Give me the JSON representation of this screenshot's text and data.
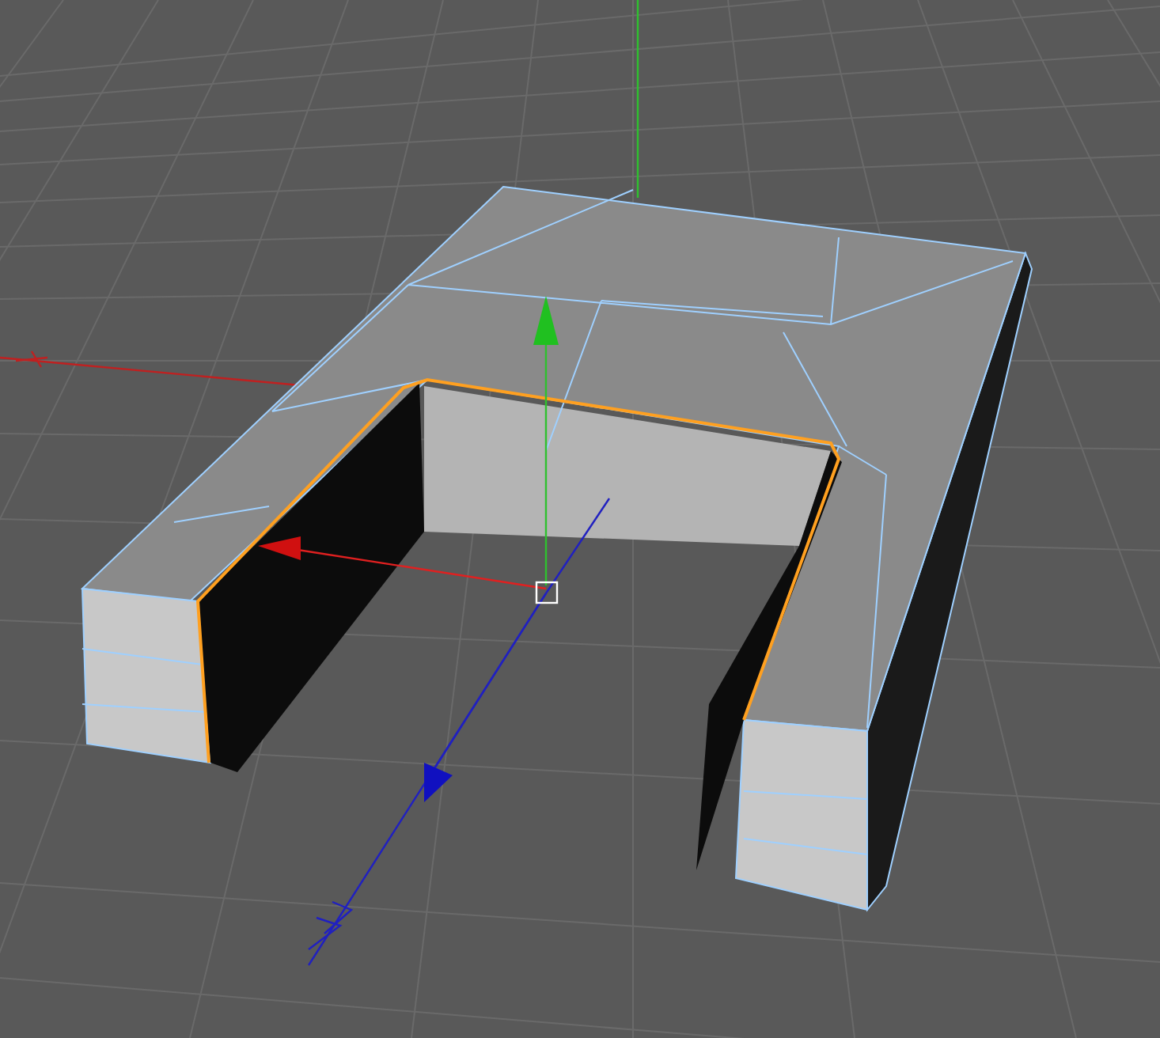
{
  "viewport": {
    "grid": true,
    "model": {
      "selected": true
    },
    "gizmo": {
      "visible": true
    }
  }
}
